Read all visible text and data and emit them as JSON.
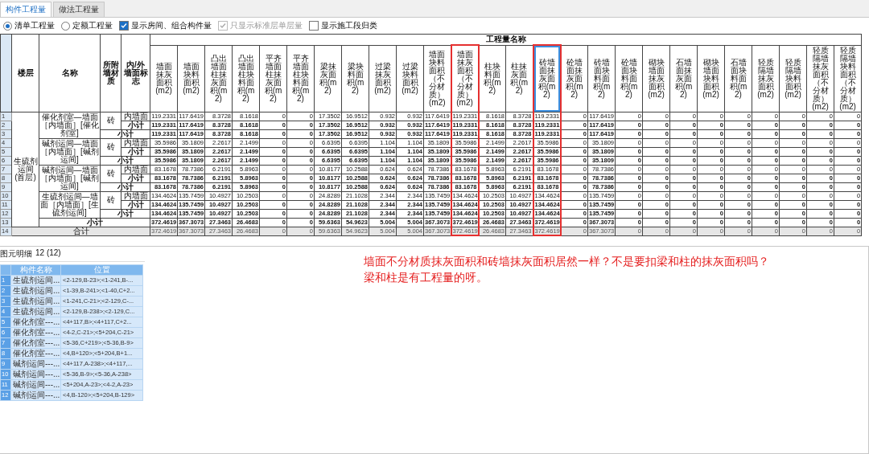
{
  "tabs": [
    {
      "label": "构件工程量",
      "selected": true
    },
    {
      "label": "做法工程量",
      "selected": false
    }
  ],
  "options": [
    {
      "kind": "radio",
      "label": "清单工程量",
      "checked": true,
      "disabled": false
    },
    {
      "kind": "radio",
      "label": "定额工程量",
      "checked": false,
      "disabled": false
    },
    {
      "kind": "checkbox",
      "label": "显示房间、组合构件量",
      "checked": true,
      "disabled": false
    },
    {
      "kind": "checkbox",
      "label": "只显示标准层单层量",
      "checked": true,
      "disabled": true
    },
    {
      "kind": "checkbox",
      "label": "显示施工段归类",
      "checked": false,
      "disabled": false
    }
  ],
  "table": {
    "fixed_headers": [
      "楼层",
      "名称",
      "所附墙材质",
      "内/外墙面标志"
    ],
    "group_header": "工程量名称",
    "columns": [
      {
        "label": "墙面抹灰面积(m2)",
        "highlighted": false,
        "selected": false
      },
      {
        "label": "墙面块料面积(m2)",
        "highlighted": false,
        "selected": false
      },
      {
        "label": "凸出墙面柱抹灰面积(m2)",
        "highlighted": false,
        "selected": false
      },
      {
        "label": "凸出墙面柱块料面积(m2)",
        "highlighted": false,
        "selected": false
      },
      {
        "label": "平齐墙面柱抹灰面积(m2)",
        "highlighted": false,
        "selected": false
      },
      {
        "label": "平齐墙面柱块料面积(m2)",
        "highlighted": false,
        "selected": false
      },
      {
        "label": "梁抹灰面积(m2)",
        "highlighted": false,
        "selected": false
      },
      {
        "label": "梁块料面积(m2)",
        "highlighted": false,
        "selected": false
      },
      {
        "label": "过梁抹灰面积(m2)",
        "highlighted": false,
        "selected": false
      },
      {
        "label": "过梁块料面积(m2)",
        "highlighted": false,
        "selected": false
      },
      {
        "label": "墙面块料面积（不分材质）(m2)",
        "highlighted": false,
        "selected": false
      },
      {
        "label": "墙面抹灰面积（不分材质）(m2)",
        "highlighted": true,
        "selected": false
      },
      {
        "label": "柱块料面积(m2)",
        "highlighted": false,
        "selected": false
      },
      {
        "label": "柱抹灰面积(m2)",
        "highlighted": false,
        "selected": false
      },
      {
        "label": "砖墙面抹灰面积(m2)",
        "highlighted": true,
        "selected": true
      },
      {
        "label": "砼墙面抹灰面积(m2)",
        "highlighted": false,
        "selected": false
      },
      {
        "label": "砖墙面块料面积(m2)",
        "highlighted": false,
        "selected": false
      },
      {
        "label": "砼墙面块料面积(m2)",
        "highlighted": false,
        "selected": false
      },
      {
        "label": "砌块墙面抹灰面积(m2)",
        "highlighted": false,
        "selected": false
      },
      {
        "label": "石墙面抹灰面积(m2)",
        "highlighted": false,
        "selected": false
      },
      {
        "label": "砌块墙面块料面积(m2)",
        "highlighted": false,
        "selected": false
      },
      {
        "label": "石墙面块料面积(m2)",
        "highlighted": false,
        "selected": false
      },
      {
        "label": "轻质隔墙抹灰面积(m2)",
        "highlighted": false,
        "selected": false
      },
      {
        "label": "轻质隔墙块料面积(m2)",
        "highlighted": false,
        "selected": false
      },
      {
        "label": "轻质隔墙抹灰面积（不分材质）(m2)",
        "highlighted": false,
        "selected": false
      },
      {
        "label": "轻质隔墙块料面积（不分材质）(m2)",
        "highlighted": false,
        "selected": false
      }
    ],
    "floors": [
      {
        "name": "生硫剂运间(首层)",
        "groups": [
          {
            "name": "催化剂室—墙面［内墙面］[催化剂室]",
            "materials": [
              {
                "name": "砖",
                "rows": [
                  {
                    "no": "1",
                    "label": "内墙面",
                    "kind": "detail",
                    "values": [
                      "119.2331",
                      "117.6419",
                      "8.3728",
                      "8.1618",
                      "0",
                      "0",
                      "17.3502",
                      "16.9512",
                      "0.932",
                      "0.932",
                      "117.6419",
                      "119.2331",
                      "8.1618",
                      "8.3728",
                      "119.2331",
                      "0",
                      "117.6419",
                      "0",
                      "0",
                      "0",
                      "0",
                      "0",
                      "0",
                      "0",
                      "0",
                      "0"
                    ]
                  },
                  {
                    "no": "2",
                    "label": "小计",
                    "kind": "subtotal",
                    "values": [
                      "119.2331",
                      "117.6419",
                      "8.3728",
                      "8.1618",
                      "0",
                      "0",
                      "17.3502",
                      "16.9512",
                      "0.932",
                      "0.932",
                      "117.6419",
                      "119.2331",
                      "8.1618",
                      "8.3728",
                      "119.2331",
                      "0",
                      "117.6419",
                      "0",
                      "0",
                      "0",
                      "0",
                      "0",
                      "0",
                      "0",
                      "0",
                      "0"
                    ]
                  }
                ]
              }
            ],
            "subtotal": {
              "no": "3",
              "label": "小计",
              "kind": "subtotal",
              "values": [
                "119.2331",
                "117.6419",
                "8.3728",
                "8.1618",
                "0",
                "0",
                "17.3502",
                "16.9512",
                "0.932",
                "0.932",
                "117.6419",
                "119.2331",
                "8.1618",
                "8.3728",
                "119.2331",
                "0",
                "117.6419",
                "0",
                "0",
                "0",
                "0",
                "0",
                "0",
                "0",
                "0",
                "0"
              ]
            }
          },
          {
            "name": "碱剂运间—墙面［内墙面］[碱剂运间]",
            "materials": [
              {
                "name": "砖",
                "rows": [
                  {
                    "no": "4",
                    "label": "内墙面",
                    "kind": "detail",
                    "values": [
                      "35.5986",
                      "35.1809",
                      "2.2617",
                      "2.1499",
                      "0",
                      "0",
                      "6.6395",
                      "6.6395",
                      "1.104",
                      "1.104",
                      "35.1809",
                      "35.5986",
                      "2.1499",
                      "2.2617",
                      "35.5986",
                      "0",
                      "35.1809",
                      "0",
                      "0",
                      "0",
                      "0",
                      "0",
                      "0",
                      "0",
                      "0",
                      "0"
                    ]
                  },
                  {
                    "no": "5",
                    "label": "小计",
                    "kind": "subtotal",
                    "values": [
                      "35.5986",
                      "35.1809",
                      "2.2617",
                      "2.1499",
                      "0",
                      "0",
                      "6.6395",
                      "6.6395",
                      "1.104",
                      "1.104",
                      "35.1809",
                      "35.5986",
                      "2.1499",
                      "2.2617",
                      "35.5986",
                      "0",
                      "35.1809",
                      "0",
                      "0",
                      "0",
                      "0",
                      "0",
                      "0",
                      "0",
                      "0",
                      "0"
                    ]
                  }
                ]
              }
            ],
            "subtotal": {
              "no": "6",
              "label": "小计",
              "kind": "subtotal",
              "values": [
                "35.5986",
                "35.1809",
                "2.2617",
                "2.1499",
                "0",
                "0",
                "6.6395",
                "6.6395",
                "1.104",
                "1.104",
                "35.1809",
                "35.5986",
                "2.1499",
                "2.2617",
                "35.5986",
                "0",
                "35.1809",
                "0",
                "0",
                "0",
                "0",
                "0",
                "0",
                "0",
                "0",
                "0"
              ]
            }
          },
          {
            "name": "碱剂运间—墙面［内墙面］[碱剂运间]",
            "materials": [
              {
                "name": "砖",
                "rows": [
                  {
                    "no": "7",
                    "label": "内墙面",
                    "kind": "detail",
                    "values": [
                      "83.1678",
                      "78.7386",
                      "6.2191",
                      "5.8963",
                      "0",
                      "0",
                      "10.8177",
                      "10.2588",
                      "0.624",
                      "0.624",
                      "78.7386",
                      "83.1678",
                      "5.8963",
                      "6.2191",
                      "83.1678",
                      "0",
                      "78.7386",
                      "0",
                      "0",
                      "0",
                      "0",
                      "0",
                      "0",
                      "0",
                      "0",
                      "0"
                    ]
                  },
                  {
                    "no": "8",
                    "label": "小计",
                    "kind": "subtotal",
                    "values": [
                      "83.1678",
                      "78.7386",
                      "6.2191",
                      "5.8963",
                      "0",
                      "0",
                      "10.8177",
                      "10.2588",
                      "0.624",
                      "0.624",
                      "78.7386",
                      "83.1678",
                      "5.8963",
                      "6.2191",
                      "83.1678",
                      "0",
                      "78.7386",
                      "0",
                      "0",
                      "0",
                      "0",
                      "0",
                      "0",
                      "0",
                      "0",
                      "0"
                    ]
                  }
                ]
              }
            ],
            "subtotal": {
              "no": "9",
              "label": "小计",
              "kind": "subtotal",
              "values": [
                "83.1678",
                "78.7386",
                "6.2191",
                "5.8963",
                "0",
                "0",
                "10.8177",
                "10.2588",
                "0.624",
                "0.624",
                "78.7386",
                "83.1678",
                "5.8963",
                "6.2191",
                "83.1678",
                "0",
                "78.7386",
                "0",
                "0",
                "0",
                "0",
                "0",
                "0",
                "0",
                "0",
                "0"
              ]
            }
          },
          {
            "name": "生硫剂运间—墙面［内墙面］[生硫剂运间]",
            "materials": [
              {
                "name": "砖",
                "rows": [
                  {
                    "no": "10",
                    "label": "内墙面",
                    "kind": "detail",
                    "values": [
                      "134.4624",
                      "135.7459",
                      "10.4927",
                      "10.2503",
                      "0",
                      "0",
                      "24.8289",
                      "21.1028",
                      "2.344",
                      "2.344",
                      "135.7459",
                      "134.4624",
                      "10.2503",
                      "10.4927",
                      "134.4624",
                      "0",
                      "135.7459",
                      "0",
                      "0",
                      "0",
                      "0",
                      "0",
                      "0",
                      "0",
                      "0",
                      "0"
                    ]
                  },
                  {
                    "no": "11",
                    "label": "小计",
                    "kind": "subtotal",
                    "values": [
                      "134.4624",
                      "135.7459",
                      "10.4927",
                      "10.2503",
                      "0",
                      "0",
                      "24.8289",
                      "21.1028",
                      "2.344",
                      "2.344",
                      "135.7459",
                      "134.4624",
                      "10.2503",
                      "10.4927",
                      "134.4624",
                      "0",
                      "135.7459",
                      "0",
                      "0",
                      "0",
                      "0",
                      "0",
                      "0",
                      "0",
                      "0",
                      "0"
                    ]
                  }
                ]
              }
            ],
            "subtotal": {
              "no": "12",
              "label": "小计",
              "kind": "subtotal",
              "values": [
                "134.4624",
                "135.7459",
                "10.4927",
                "10.2503",
                "0",
                "0",
                "24.8289",
                "21.1028",
                "2.344",
                "2.344",
                "135.7459",
                "134.4624",
                "10.2503",
                "10.4927",
                "134.4624",
                "0",
                "135.7459",
                "0",
                "0",
                "0",
                "0",
                "0",
                "0",
                "0",
                "0",
                "0"
              ]
            }
          }
        ],
        "subtotal": {
          "no": "13",
          "label": "小计",
          "kind": "subtotal",
          "values": [
            "372.4619",
            "367.3073",
            "27.3463",
            "26.4683",
            "0",
            "0",
            "59.6363",
            "54.9623",
            "5.004",
            "5.004",
            "367.3073",
            "372.4619",
            "26.4683",
            "27.3463",
            "372.4619",
            "0",
            "367.3073",
            "0",
            "0",
            "0",
            "0",
            "0",
            "0",
            "0",
            "0",
            "0"
          ]
        }
      }
    ],
    "total": {
      "no": "14",
      "label": "合计",
      "kind": "total",
      "values": [
        "372.4619",
        "367.3073",
        "27.3463",
        "26.4683",
        "0",
        "0",
        "59.6363",
        "54.9623",
        "5.004",
        "5.004",
        "367.3073",
        "372.4619",
        "26.4683",
        "27.3463",
        "372.4619",
        "0",
        "367.3073",
        "0",
        "0",
        "0",
        "0",
        "0",
        "0",
        "0",
        "0",
        "0"
      ]
    }
  },
  "detail_panel": {
    "title": "图元明细",
    "count": "12 (12)",
    "columns": [
      "构件名称",
      "位置"
    ],
    "rows": [
      {
        "no": "1",
        "name": "生硫剂运间...",
        "position": "<2-129,B-23>;<1-241,B-..."
      },
      {
        "no": "2",
        "name": "生硫剂运间...",
        "position": "<1-39,B-241>;<1-40,C+2..."
      },
      {
        "no": "3",
        "name": "生硫剂运间...",
        "position": "<1-241,C-21>;<2-129,C-..."
      },
      {
        "no": "4",
        "name": "生硫剂运间...",
        "position": "<2-129,B-238>;<2-129,C..."
      },
      {
        "no": "5",
        "name": "催化剂室---...",
        "position": "<4+117,B>;<4+117,C+2..."
      },
      {
        "no": "6",
        "name": "催化剂室---...",
        "position": "<4-2,C-21>;<5+204,C-21>"
      },
      {
        "no": "7",
        "name": "催化剂室---...",
        "position": "<5-36,C+219>;<5-36,B-9>"
      },
      {
        "no": "8",
        "name": "催化剂室---...",
        "position": "<4,B+120>;<5+204,B+1..."
      },
      {
        "no": "9",
        "name": "碱剂运间---...",
        "position": "<4+117,A-238>;<4+117,..."
      },
      {
        "no": "10",
        "name": "碱剂运间---...",
        "position": "<5-36,B-9>;<5-36,A-238>"
      },
      {
        "no": "11",
        "name": "碱剂运间---...",
        "position": "<5+204,A-23>;<4-2,A-23>"
      },
      {
        "no": "12",
        "name": "碱剂运间---...",
        "position": "<4,B-120>;<5+204,B-129>"
      }
    ]
  },
  "annotation": [
    "墙面不分材质抹灰面积和砖墙抹灰面积居然一样？不是要扣梁和柱的抹灰面积吗？",
    "梁和柱是有工程量的呀。"
  ]
}
